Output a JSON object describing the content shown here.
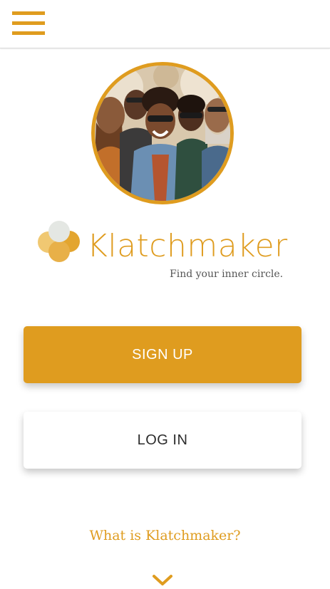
{
  "header": {
    "menu_icon": "hamburger-menu-icon"
  },
  "hero": {
    "image": "group-of-smiling-friends-photo"
  },
  "brand": {
    "name": "Klatchmaker",
    "tagline": "Find your inner circle.",
    "logo_icon": "overlapping-circles-logo-icon"
  },
  "actions": {
    "signup_label": "SIGN UP",
    "login_label": "LOG IN"
  },
  "info": {
    "what_is_label": "What is Klatchmaker?",
    "expand_icon": "chevron-down-icon"
  },
  "colors": {
    "accent": "#df9c1f",
    "accent_light": "#f0c872",
    "accent_mid": "#e8b048",
    "pale": "#e4e7e3",
    "text_dark": "#2b2b2b",
    "tagline_gray": "#555555"
  }
}
